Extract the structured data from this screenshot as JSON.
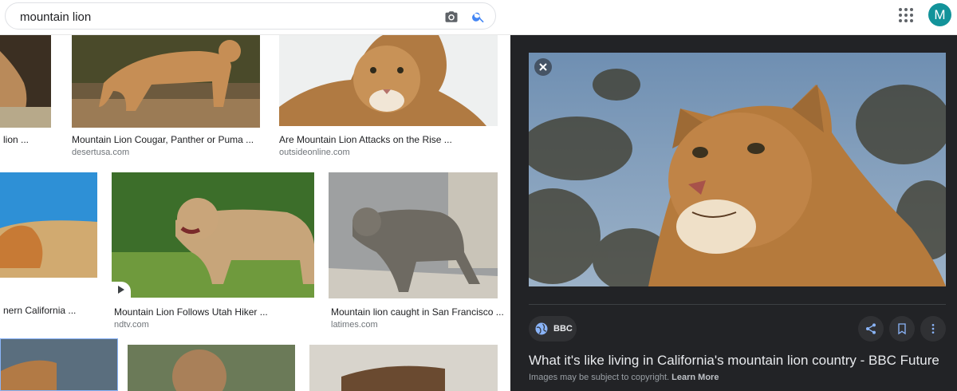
{
  "search": {
    "query": "mountain lion"
  },
  "header": {
    "avatar_letter": "M"
  },
  "icons": {
    "camera": "camera-icon",
    "search": "search-icon",
    "apps": "apps-grid-icon",
    "close": "close-icon",
    "globe": "globe-icon",
    "share": "share-icon",
    "bookmark": "bookmark-icon",
    "more": "more-vert-icon",
    "play": "play-icon"
  },
  "colors": {
    "accent": "#4285f4",
    "avatar": "#12939a",
    "panel_bg": "#222326"
  },
  "results": [
    {
      "title": "lion ...",
      "source": ""
    },
    {
      "title": "Mountain Lion Cougar, Panther or Puma ...",
      "source": "desertusa.com"
    },
    {
      "title": "Are Mountain Lion Attacks on the Rise ...",
      "source": "outsideonline.com"
    },
    {
      "title": "nern California ...",
      "source": ""
    },
    {
      "title": "Mountain Lion Follows Utah Hiker ...",
      "source": "ndtv.com"
    },
    {
      "title": "Mountain lion caught in San Francisco ...",
      "source": "latimes.com"
    }
  ],
  "preview": {
    "source_label": "BBC",
    "title": "What it's like living in California's mountain lion country - BBC Future",
    "copyright": "Images may be subject to copyright.",
    "learn_more": "Learn More"
  }
}
